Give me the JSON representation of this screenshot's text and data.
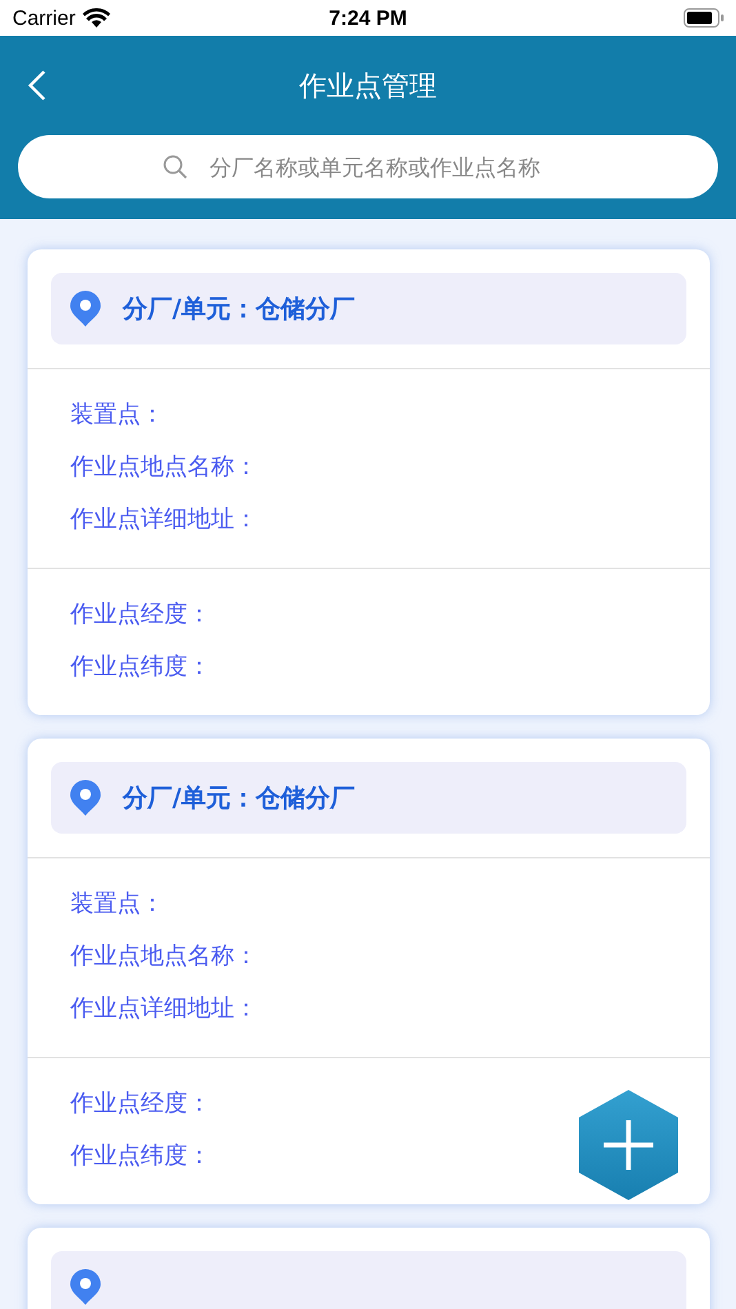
{
  "status_bar": {
    "carrier": "Carrier",
    "time": "7:24 PM"
  },
  "nav_bar": {
    "title": "作业点管理"
  },
  "search": {
    "placeholder": "分厂名称或单元名称或作业点名称"
  },
  "cards": [
    {
      "kind": "full",
      "unit": "分厂/单元：仓储分厂",
      "fields": [
        "装置点：",
        "作业点地点名称：",
        "作业点详细地址："
      ],
      "coords": [
        "作业点经度：",
        "作业点纬度："
      ]
    },
    {
      "kind": "full",
      "unit": "分厂/单元：仓储分厂",
      "fields": [
        "装置点：",
        "作业点地点名称：",
        "作业点详细地址："
      ],
      "coords": [
        "作业点经度：",
        "作业点纬度："
      ]
    },
    {
      "kind": "cut"
    }
  ]
}
